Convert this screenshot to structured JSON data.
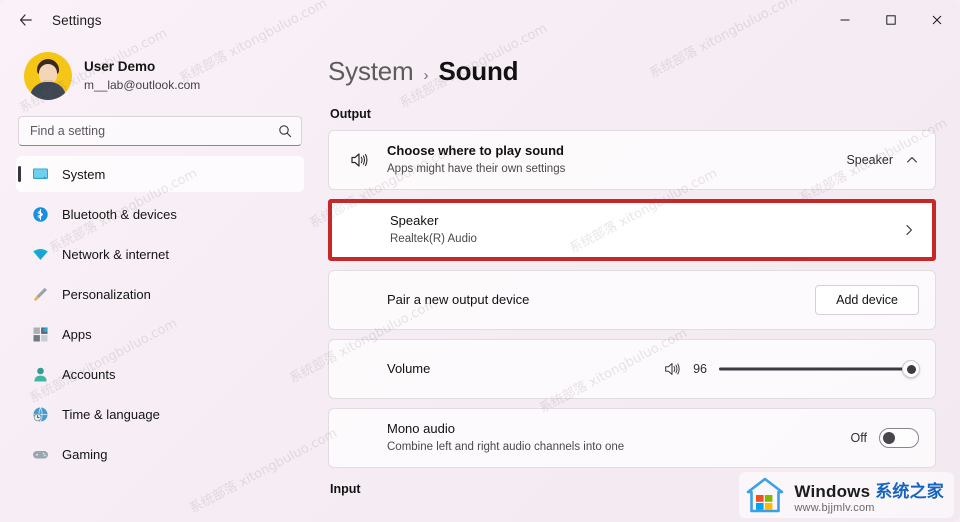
{
  "window": {
    "title": "Settings",
    "back_icon": "back-arrow-icon",
    "minimize_label": "—",
    "maximize_label": "□",
    "close_label": "✕"
  },
  "sidebar": {
    "profile": {
      "name": "User Demo",
      "email": "m__lab@outlook.com"
    },
    "search": {
      "placeholder": "Find a setting",
      "value": ""
    },
    "items": [
      {
        "label": "System",
        "icon": "monitor-icon",
        "active": true
      },
      {
        "label": "Bluetooth & devices",
        "icon": "bluetooth-icon",
        "active": false
      },
      {
        "label": "Network & internet",
        "icon": "wifi-icon",
        "active": false
      },
      {
        "label": "Personalization",
        "icon": "brush-icon",
        "active": false
      },
      {
        "label": "Apps",
        "icon": "apps-icon",
        "active": false
      },
      {
        "label": "Accounts",
        "icon": "account-icon",
        "active": false
      },
      {
        "label": "Time & language",
        "icon": "clock-globe-icon",
        "active": false
      },
      {
        "label": "Gaming",
        "icon": "gamepad-icon",
        "active": false
      }
    ]
  },
  "breadcrumb": {
    "parent": "System",
    "separator": "›",
    "current": "Sound"
  },
  "main": {
    "output_section_label": "Output",
    "input_section_label": "Input",
    "choose_output": {
      "title": "Choose where to play sound",
      "subtitle": "Apps might have their own settings",
      "value": "Speaker",
      "icon": "speaker-icon",
      "chevron": "chevron-up-icon"
    },
    "selected_device": {
      "title": "Speaker",
      "subtitle": "Realtek(R) Audio",
      "chevron": "chevron-right-icon",
      "highlight_color": "#c62828"
    },
    "pair_device": {
      "title": "Pair a new output device",
      "button_label": "Add device"
    },
    "volume": {
      "title": "Volume",
      "value": "96",
      "percent": 96,
      "icon": "speaker-icon"
    },
    "mono_audio": {
      "title": "Mono audio",
      "subtitle": "Combine left and right audio channels into one",
      "state_label": "Off",
      "state_on": false
    }
  },
  "watermark": {
    "tiles": [
      "系统部落 xitongbuluo.com",
      "系统部落 xitongbuluo.com",
      "系统部落 xitongbuluo.com",
      "系统部落 xitongbuluo.com",
      "系统部落 xitongbuluo.com",
      "系统部落 xitongbuluo.com",
      "系统部落 xitongbuluo.com",
      "系统部落 xitongbuluo.com",
      "系统部落 xitongbuluo.com",
      "系统部落 xitongbuluo.com",
      "系统部落 xitongbuluo.com",
      "系统部落 xitongbuluo.com"
    ],
    "logo_main": "Windows ",
    "logo_cn": "系统之家",
    "logo_url": "www.bjjmlv.com"
  }
}
